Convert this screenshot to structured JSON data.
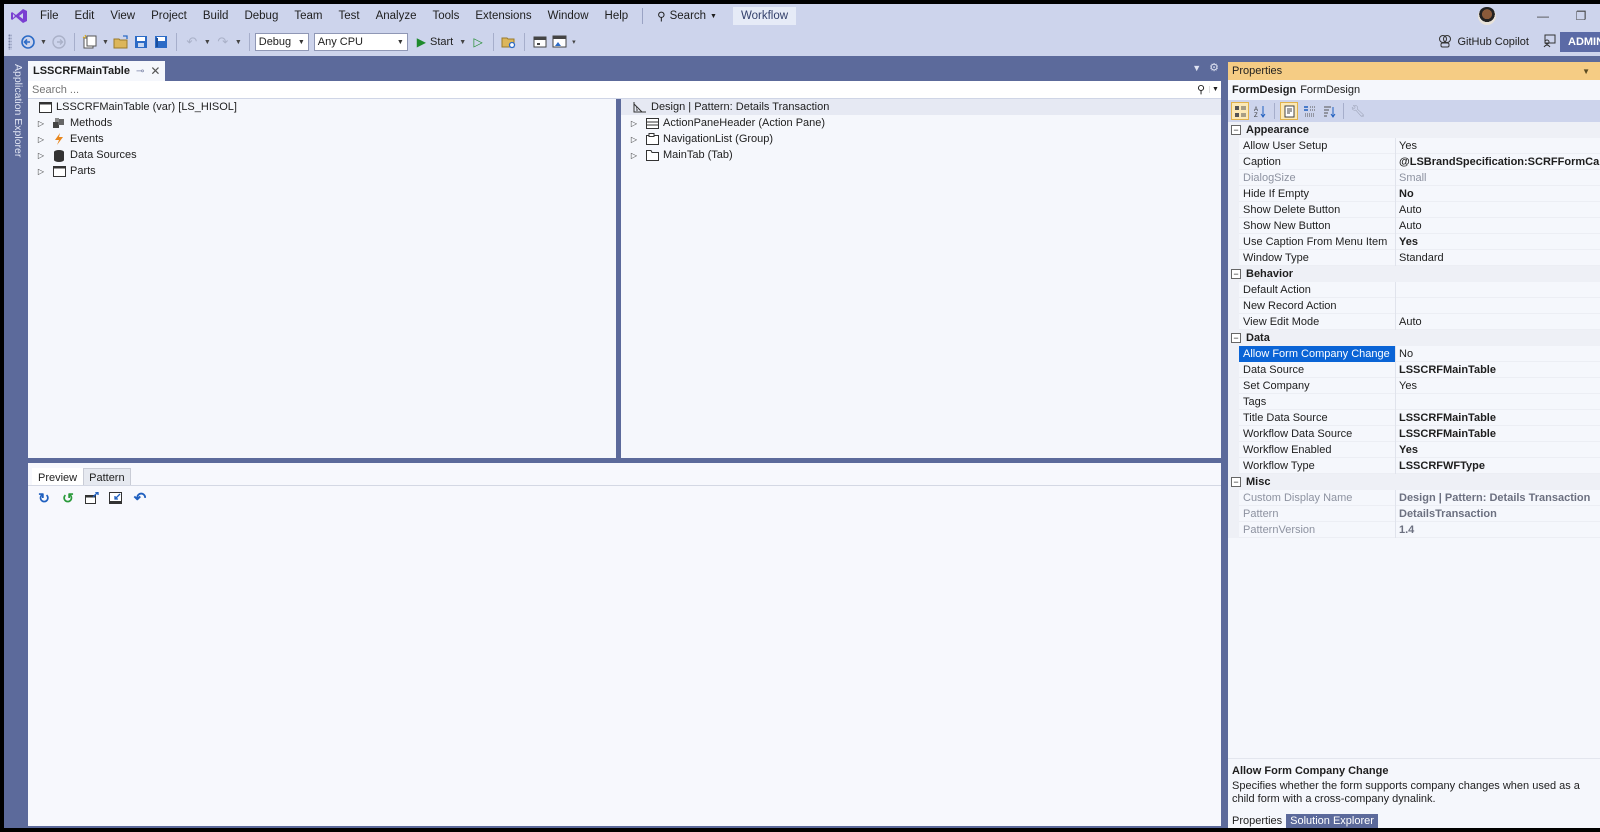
{
  "app": {
    "menu": [
      "File",
      "Edit",
      "View",
      "Project",
      "Build",
      "Debug",
      "Team",
      "Test",
      "Analyze",
      "Tools",
      "Extensions",
      "Window",
      "Help"
    ],
    "search_label": "Search",
    "workflow_badge": "Workflow",
    "window_controls": {
      "minimize": "—",
      "restore": "❐"
    },
    "copilot_label": "GitHub Copilot",
    "admin_label": "ADMIN"
  },
  "toolbar": {
    "config": "Debug",
    "platform": "Any CPU",
    "start_label": "Start"
  },
  "sidebar": {
    "tab_label": "Application Explorer"
  },
  "document": {
    "tab_label": "LSSCRFMainTable",
    "search_placeholder": "Search ...",
    "tree_root": "LSSCRFMainTable (var) [LS_HISOL]",
    "tree_items": [
      {
        "label": "Methods",
        "icon": "methods-icon"
      },
      {
        "label": "Events",
        "icon": "lightning-icon"
      },
      {
        "label": "Data Sources",
        "icon": "database-icon"
      },
      {
        "label": "Parts",
        "icon": "window-icon"
      }
    ],
    "design_header": "Design | Pattern: Details Transaction",
    "design_items": [
      {
        "label": "ActionPaneHeader (Action Pane)",
        "icon": "action-pane-icon"
      },
      {
        "label": "NavigationList (Group)",
        "icon": "group-icon"
      },
      {
        "label": "MainTab (Tab)",
        "icon": "tab-icon"
      }
    ],
    "bottom_tabs": [
      "Preview",
      "Pattern"
    ],
    "bottom_tools": [
      "refresh-icon",
      "refresh-green-icon",
      "pop-out-icon",
      "dock-in-icon",
      "undo-icon"
    ]
  },
  "properties": {
    "title": "Properties",
    "object_name": "FormDesign",
    "object_type": "FormDesign",
    "categories": [
      {
        "name": "Appearance",
        "rows": [
          {
            "name": "Allow User Setup",
            "value": "Yes",
            "bold": false,
            "disabled": false
          },
          {
            "name": "Caption",
            "value": "@LSBrandSpecification:SCRFFormCaption",
            "bold": true,
            "disabled": false
          },
          {
            "name": "DialogSize",
            "value": "Small",
            "bold": false,
            "disabled": true
          },
          {
            "name": "Hide If Empty",
            "value": "No",
            "bold": true,
            "disabled": false
          },
          {
            "name": "Show Delete Button",
            "value": "Auto",
            "bold": false,
            "disabled": false
          },
          {
            "name": "Show New Button",
            "value": "Auto",
            "bold": false,
            "disabled": false
          },
          {
            "name": "Use Caption From Menu Item",
            "value": "Yes",
            "bold": true,
            "disabled": false
          },
          {
            "name": "Window Type",
            "value": "Standard",
            "bold": false,
            "disabled": false
          }
        ]
      },
      {
        "name": "Behavior",
        "rows": [
          {
            "name": "Default Action",
            "value": "",
            "bold": false,
            "disabled": false
          },
          {
            "name": "New Record Action",
            "value": "",
            "bold": false,
            "disabled": false
          },
          {
            "name": "View Edit Mode",
            "value": "Auto",
            "bold": false,
            "disabled": false
          }
        ]
      },
      {
        "name": "Data",
        "rows": [
          {
            "name": "Allow Form Company Change",
            "value": "No",
            "bold": false,
            "disabled": false,
            "selected": true
          },
          {
            "name": "Data Source",
            "value": "LSSCRFMainTable",
            "bold": true,
            "disabled": false
          },
          {
            "name": "Set Company",
            "value": "Yes",
            "bold": false,
            "disabled": false
          },
          {
            "name": "Tags",
            "value": "",
            "bold": false,
            "disabled": false
          },
          {
            "name": "Title Data Source",
            "value": "LSSCRFMainTable",
            "bold": true,
            "disabled": false
          },
          {
            "name": "Workflow Data Source",
            "value": "LSSCRFMainTable",
            "bold": true,
            "disabled": false
          },
          {
            "name": "Workflow Enabled",
            "value": "Yes",
            "bold": true,
            "disabled": false
          },
          {
            "name": "Workflow Type",
            "value": "LSSCRFWFType",
            "bold": true,
            "disabled": false
          }
        ]
      },
      {
        "name": "Misc",
        "rows": [
          {
            "name": "Custom Display Name",
            "value": "Design | Pattern: Details Transaction",
            "bold": true,
            "disabled": true
          },
          {
            "name": "Pattern",
            "value": "DetailsTransaction",
            "bold": true,
            "disabled": true
          },
          {
            "name": "PatternVersion",
            "value": "1.4",
            "bold": true,
            "disabled": true
          }
        ]
      }
    ],
    "description_title": "Allow Form Company Change",
    "description_text": "Specifies whether the form supports company changes when used as a child form with a cross-company dynalink.",
    "bottom_tabs": [
      "Properties",
      "Solution Explorer"
    ]
  }
}
